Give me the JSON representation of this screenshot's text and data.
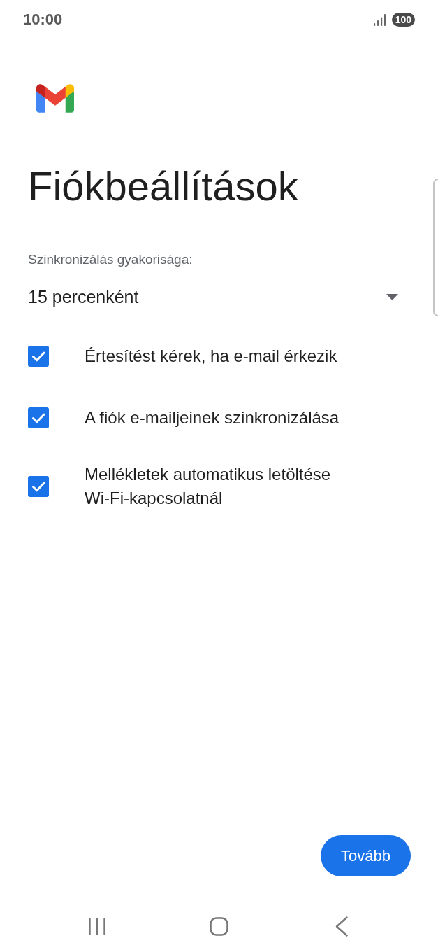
{
  "status_bar": {
    "time": "10:00",
    "battery": "100"
  },
  "title": "Fiókbeállítások",
  "sync": {
    "label": "Szinkronizálás gyakorisága:",
    "value": "15 percenként"
  },
  "options": [
    {
      "label": "Értesítést kérek, ha e-mail érkezik",
      "checked": true
    },
    {
      "label": "A fiók e-mailjeinek szinkronizálása",
      "checked": true
    },
    {
      "label": "Mellékletek automatikus letöltése Wi-Fi-kapcsolatnál",
      "checked": true
    }
  ],
  "next_button": "Tovább"
}
